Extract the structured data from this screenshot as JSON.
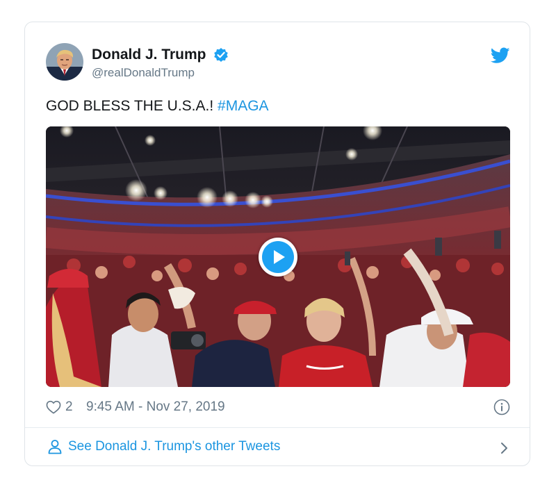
{
  "author": {
    "display_name": "Donald J. Trump",
    "handle": "@realDonaldTrump",
    "verified": true
  },
  "icons": {
    "verified": "verified-badge-icon",
    "brand": "twitter-bird-icon",
    "like": "heart-icon",
    "info": "info-icon",
    "profile": "person-icon",
    "more": "chevron-right-icon",
    "video": "play-icon"
  },
  "tweet": {
    "text": "GOD BLESS THE U.S.A.!",
    "hashtag": "#MAGA"
  },
  "stats": {
    "likes": "2",
    "timestamp": "9:45 AM - Nov 27, 2019"
  },
  "footer": {
    "label": "See Donald J. Trump's other Tweets"
  },
  "colors": {
    "brand": "#1da1f2",
    "link": "#1b95e0",
    "text": "#14171a",
    "muted": "#657786",
    "border": "#dfe4e8"
  }
}
